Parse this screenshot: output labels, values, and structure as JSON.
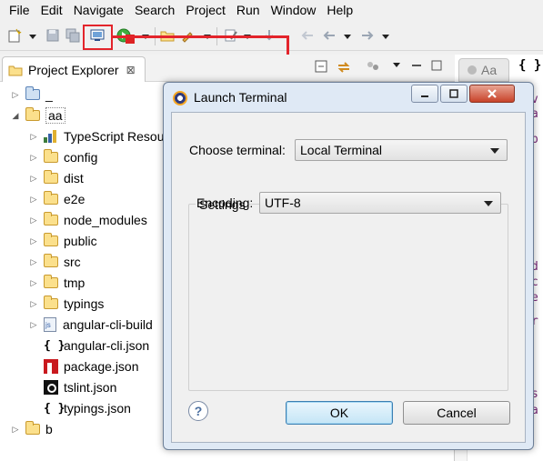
{
  "menubar": {
    "items": [
      "File",
      "Edit",
      "Navigate",
      "Search",
      "Project",
      "Run",
      "Window",
      "Help"
    ]
  },
  "explorer": {
    "tab_label": "Project Explorer",
    "close_glyph": "⊠",
    "tree": [
      {
        "label": "_",
        "level": 0,
        "expanded": false,
        "icon": "folder-blue"
      },
      {
        "label": "aa",
        "level": 0,
        "expanded": true,
        "icon": "folder-project"
      },
      {
        "label": "TypeScript Resou",
        "level": 1,
        "expanded": false,
        "icon": "typescript-library-icon"
      },
      {
        "label": "config",
        "level": 1,
        "expanded": false,
        "icon": "folder"
      },
      {
        "label": "dist",
        "level": 1,
        "expanded": false,
        "icon": "folder"
      },
      {
        "label": "e2e",
        "level": 1,
        "expanded": false,
        "icon": "folder"
      },
      {
        "label": "node_modules",
        "level": 1,
        "expanded": false,
        "icon": "folder"
      },
      {
        "label": "public",
        "level": 1,
        "expanded": false,
        "icon": "folder"
      },
      {
        "label": "src",
        "level": 1,
        "expanded": false,
        "icon": "folder"
      },
      {
        "label": "tmp",
        "level": 1,
        "expanded": false,
        "icon": "folder"
      },
      {
        "label": "typings",
        "level": 1,
        "expanded": false,
        "icon": "folder"
      },
      {
        "label": "angular-cli-build",
        "level": 1,
        "expanded": false,
        "icon": "js-file-icon"
      },
      {
        "label": "angular-cli.json",
        "level": 1,
        "expanded": null,
        "icon": "json-icon"
      },
      {
        "label": "package.json",
        "level": 1,
        "expanded": null,
        "icon": "npm-icon"
      },
      {
        "label": "tslint.json",
        "level": 1,
        "expanded": null,
        "icon": "tslint-icon"
      },
      {
        "label": "typings.json",
        "level": 1,
        "expanded": null,
        "icon": "json-icon"
      },
      {
        "label": "b",
        "level": 0,
        "expanded": false,
        "icon": "folder-project"
      }
    ]
  },
  "editor": {
    "tab1_label": "Aa",
    "tab2_label": "{ }",
    "fragments": [
      "v",
      "a",
      "p",
      "d",
      "c",
      "e",
      "r",
      "s",
      "a"
    ]
  },
  "dialog": {
    "title": "Launch Terminal",
    "choose_terminal_label": "Choose terminal:",
    "choose_terminal_value": "Local Terminal",
    "settings_group_label": "Settings",
    "encoding_label": "Encoding:",
    "encoding_value": "UTF-8",
    "help_glyph": "?",
    "ok_label": "OK",
    "cancel_label": "Cancel"
  },
  "colors": {
    "highlight": "#e3242b",
    "dialog_frame": "#dfe9f5",
    "default_button": "#c4e5f6"
  }
}
